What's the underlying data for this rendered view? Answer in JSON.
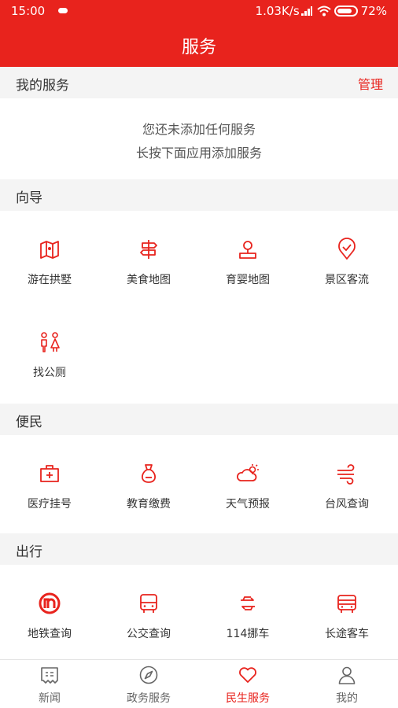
{
  "status_bar": {
    "time": "15:00",
    "network_speed": "1.03K/s",
    "battery": "72%"
  },
  "header": {
    "title": "服务"
  },
  "my_services": {
    "label": "我的服务",
    "manage_label": "管理",
    "empty_line1": "您还未添加任何服务",
    "empty_line2": "长按下面应用添加服务"
  },
  "sections": {
    "guide": {
      "label": "向导",
      "items": [
        {
          "label": "游在拱墅",
          "icon": "map-icon"
        },
        {
          "label": "美食地图",
          "icon": "signpost-icon"
        },
        {
          "label": "育婴地图",
          "icon": "location-person-icon"
        },
        {
          "label": "景区客流",
          "icon": "location-check-icon"
        },
        {
          "label": "找公厕",
          "icon": "restroom-icon"
        }
      ]
    },
    "convenience": {
      "label": "便民",
      "items": [
        {
          "label": "医疗挂号",
          "icon": "medical-kit-icon"
        },
        {
          "label": "教育缴费",
          "icon": "money-bag-icon"
        },
        {
          "label": "天气预报",
          "icon": "weather-icon"
        },
        {
          "label": "台风查询",
          "icon": "wind-icon"
        }
      ]
    },
    "travel": {
      "label": "出行",
      "items": [
        {
          "label": "地铁查询",
          "icon": "metro-icon"
        },
        {
          "label": "公交查询",
          "icon": "bus-icon"
        },
        {
          "label": "114挪车",
          "icon": "car-swap-icon"
        },
        {
          "label": "长途客车",
          "icon": "coach-icon"
        }
      ]
    }
  },
  "tabbar": {
    "items": [
      {
        "label": "新闻",
        "icon": "news-icon"
      },
      {
        "label": "政务服务",
        "icon": "compass-icon"
      },
      {
        "label": "民生服务",
        "icon": "heart-icon",
        "active": true
      },
      {
        "label": "我的",
        "icon": "user-icon"
      }
    ]
  },
  "colors": {
    "accent": "#e8231d",
    "section_bg": "#f4f4f4",
    "text": "#333333"
  }
}
